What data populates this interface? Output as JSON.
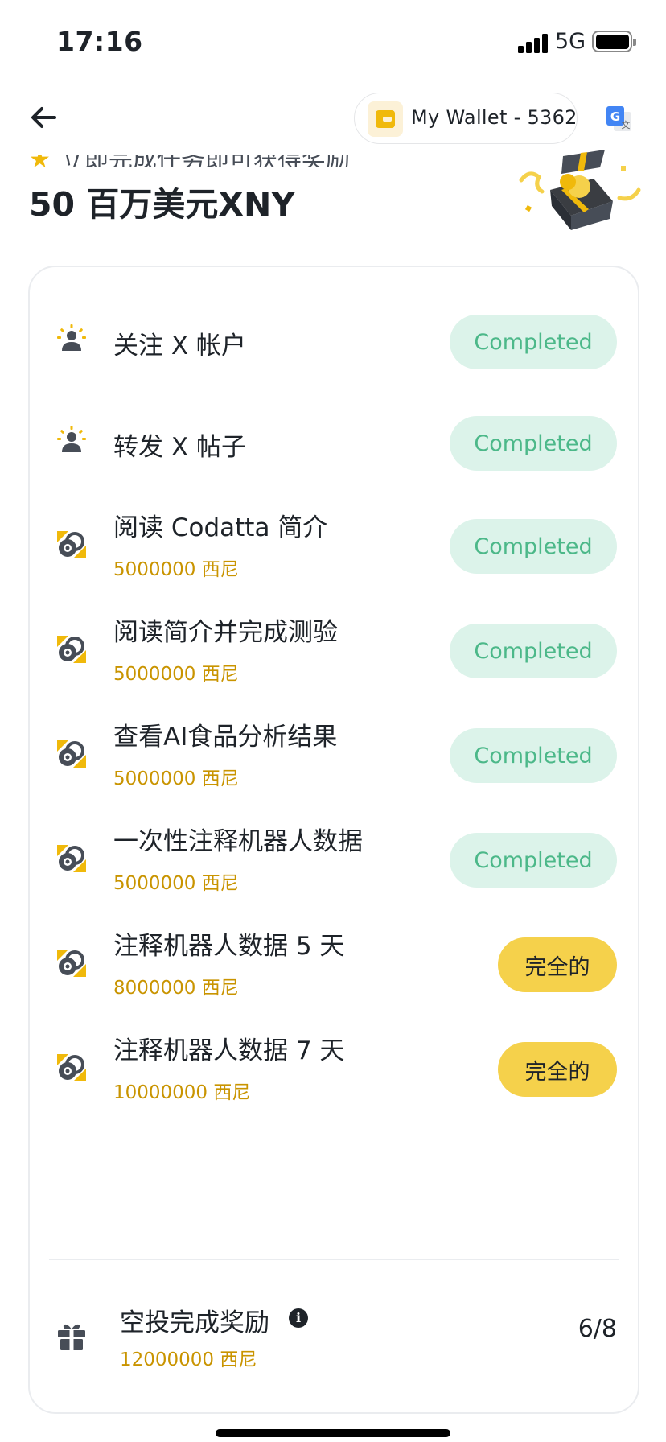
{
  "status_bar": {
    "time": "17:16",
    "network": "5G"
  },
  "nav": {
    "back_icon": "arrow-left-icon",
    "wallet_label": "My Wallet - 5362",
    "wallet_icon": "wallet-icon",
    "translate_icon": "google-translate-icon"
  },
  "header": {
    "subtitle": "立即完成任务即可获得奖励",
    "title": "50 百万美元XNY"
  },
  "colors": {
    "accent": "#f0b90b",
    "completed_bg": "#dcf3ea",
    "completed_text": "#4cb889",
    "pending_bg": "#f5d14b",
    "reward_text": "#c99400"
  },
  "tasks": [
    {
      "icon": "people-icon",
      "title": "关注 X 帐户",
      "reward": "",
      "status": "Completed"
    },
    {
      "icon": "people-icon",
      "title": "转发 X 帖子",
      "reward": "",
      "status": "Completed"
    },
    {
      "icon": "coin-icon",
      "title": "阅读 Codatta 简介",
      "reward": "5000000 西尼",
      "status": "Completed"
    },
    {
      "icon": "coin-icon",
      "title": "阅读简介并完成测验",
      "reward": "5000000 西尼",
      "status": "Completed"
    },
    {
      "icon": "coin-icon",
      "title": "查看AI食品分析结果",
      "reward": "5000000 西尼",
      "status": "Completed"
    },
    {
      "icon": "coin-icon",
      "title": "一次性注释机器人数据",
      "reward": "5000000 西尼",
      "status": "Completed"
    },
    {
      "icon": "coin-icon",
      "title": "注释机器人数据 5 天",
      "reward": "8000000 西尼",
      "status": "完全的"
    },
    {
      "icon": "coin-icon",
      "title": "注释机器人数据 7 天",
      "reward": "10000000 西尼",
      "status": "完全的"
    }
  ],
  "completion_reward": {
    "icon": "gift-icon",
    "title": "空投完成奖励",
    "info_icon": "info-icon",
    "amount": "12000000 西尼",
    "progress": "6/8"
  }
}
